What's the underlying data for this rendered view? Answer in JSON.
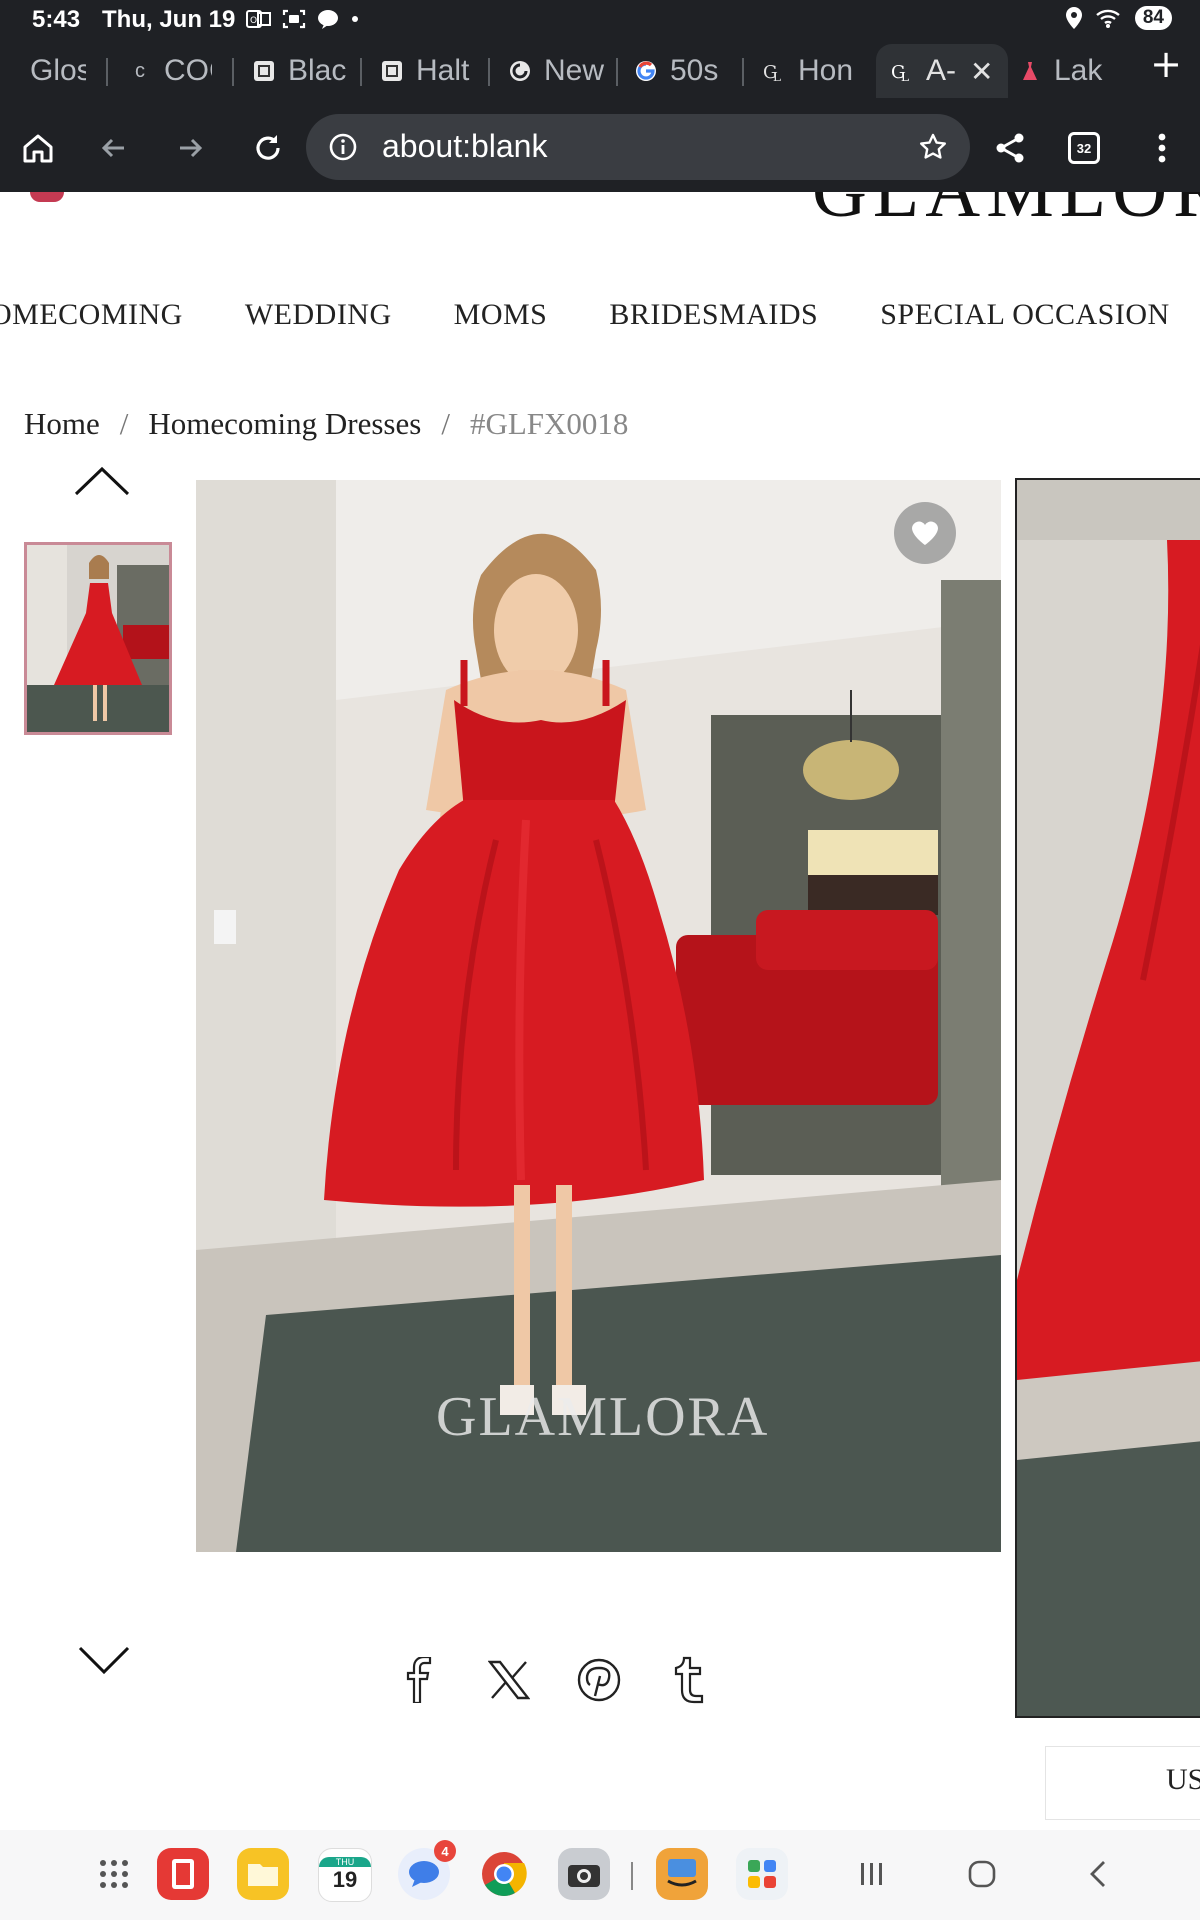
{
  "status_bar": {
    "time": "5:43",
    "date": "Thu, Jun 19",
    "battery": "84",
    "icons": [
      "outlook-icon",
      "screenshot-icon",
      "chat-icon",
      "dot-icon",
      "location-icon",
      "wifi-icon"
    ]
  },
  "tabs": [
    {
      "label": "Glos",
      "favicon": "generic"
    },
    {
      "label": "COC",
      "favicon": "c-letter"
    },
    {
      "label": "Blac",
      "favicon": "doc"
    },
    {
      "label": "Halt",
      "favicon": "doc"
    },
    {
      "label": "New",
      "favicon": "spiral"
    },
    {
      "label": "50s",
      "favicon": "google"
    },
    {
      "label": "Hon",
      "favicon": "gl"
    },
    {
      "label": "A-",
      "favicon": "gl",
      "active": true
    },
    {
      "label": "Lak",
      "favicon": "dress"
    }
  ],
  "toolbar": {
    "url": "about:blank",
    "tab_count": "32"
  },
  "site": {
    "logo_text": "GLAMLORA",
    "nav": [
      "OMECOMING",
      "WEDDING",
      "MOMS",
      "BRIDESMAIDS",
      "SPECIAL OCCASION"
    ],
    "breadcrumb": [
      "Home",
      "Homecoming Dresses",
      "#GLFX0018"
    ],
    "watermark": "GLAMLORA",
    "currency_button": "US"
  },
  "dock": {
    "calendar_day_label": "THU",
    "calendar_day": "19",
    "messages_badge": "4"
  },
  "colors": {
    "chrome_bg": "#1f2125",
    "omnibox_bg": "#3a3d42",
    "dress_red": "#d41a1f",
    "thumb_border": "#c98a96"
  }
}
